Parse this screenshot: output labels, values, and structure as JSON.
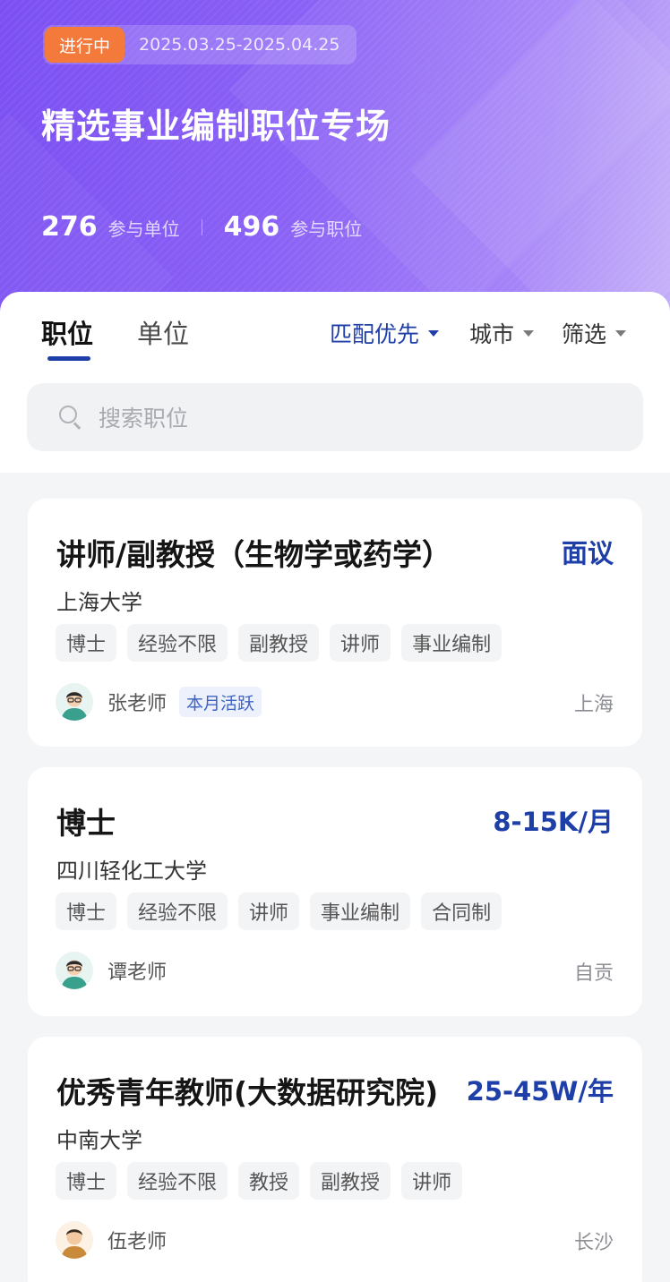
{
  "header": {
    "status": "进行中",
    "period": "2025.03.25-2025.04.25",
    "title": "精选事业编制职位专场",
    "stats": [
      {
        "value": "276",
        "label": "参与单位"
      },
      {
        "value": "496",
        "label": "参与职位"
      }
    ]
  },
  "tabs": [
    {
      "label": "职位",
      "active": true
    },
    {
      "label": "单位",
      "active": false
    }
  ],
  "filters": [
    {
      "label": "匹配优先",
      "icon": "caret-down-icon"
    },
    {
      "label": "城市",
      "icon": "caret-down-icon"
    },
    {
      "label": "筛选",
      "icon": "caret-down-icon"
    }
  ],
  "search": {
    "placeholder": "搜索职位",
    "icon": "search-icon"
  },
  "jobs": [
    {
      "title": "讲师/副教授（生物学或药学）",
      "salary": "面议",
      "org": "上海大学",
      "tags": [
        "博士",
        "经验不限",
        "副教授",
        "讲师",
        "事业编制"
      ],
      "recruiter": "张老师",
      "badge": "本月活跃",
      "city": "上海"
    },
    {
      "title": "博士",
      "salary": "8-15K/月",
      "org": "四川轻化工大学",
      "tags": [
        "博士",
        "经验不限",
        "讲师",
        "事业编制",
        "合同制"
      ],
      "recruiter": "谭老师",
      "city": "自贡"
    },
    {
      "title": "优秀青年教师(大数据研究院)",
      "salary": "25-45W/年",
      "org": "中南大学",
      "tags": [
        "博士",
        "经验不限",
        "教授",
        "副教授",
        "讲师"
      ],
      "recruiter": "伍老师",
      "city": "长沙"
    }
  ],
  "colors": {
    "accent": "#1f3fa8",
    "hero": "#8b62f6",
    "status": "#f47a3c"
  }
}
